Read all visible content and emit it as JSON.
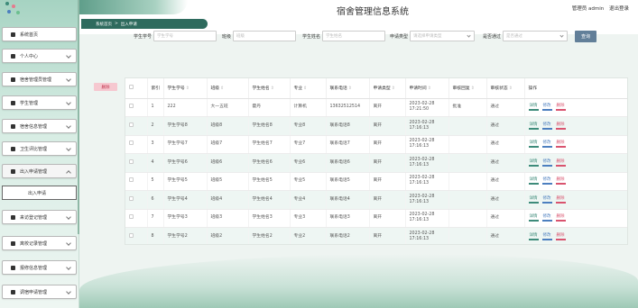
{
  "header": {
    "app_title": "宿舍管理信息系统",
    "user_role": "管理员 admin",
    "logout": "退出登录"
  },
  "breadcrumb": {
    "home": "系统首页",
    "sep": ">",
    "current": "出入申请"
  },
  "sidebar": {
    "items": [
      {
        "label": "系统首页",
        "icon": "home-icon"
      },
      {
        "label": "个人中心",
        "icon": "person-icon"
      },
      {
        "label": "宿舍管理员管理",
        "icon": "building-icon"
      },
      {
        "label": "学生管理",
        "icon": "heart-icon"
      },
      {
        "label": "宿舍信息管理",
        "icon": "building-icon"
      },
      {
        "label": "卫生评比管理",
        "icon": "person-icon"
      },
      {
        "label": "出入申请管理",
        "icon": "door-icon"
      },
      {
        "label": "出入申请",
        "icon": ""
      },
      {
        "label": "来访登记管理",
        "icon": "folder-icon"
      },
      {
        "label": "离校记录管理",
        "icon": "grid-icon"
      },
      {
        "label": "报修信息管理",
        "icon": "grid-icon"
      },
      {
        "label": "调宿申请管理",
        "icon": "sliders-icon"
      }
    ]
  },
  "search": {
    "student_no_label": "学生学号",
    "student_no_placeholder": "学生学号",
    "class_label": "班级",
    "class_placeholder": "班级",
    "student_name_label": "学生姓名",
    "student_name_placeholder": "学生姓名",
    "apply_type_label": "申请类型",
    "apply_type_placeholder": "请选择申请类型",
    "approved_label": "是否通过",
    "approved_placeholder": "是否通过",
    "query_button": "查询"
  },
  "actions": {
    "delete_button": "删除"
  },
  "table": {
    "columns": [
      "",
      "索引",
      "学生学号",
      "班级",
      "学生姓名",
      "专业",
      "联系电话",
      "申请类型",
      "申请时间",
      "审核回复",
      "审核状态",
      "操作"
    ],
    "op_labels": {
      "view": "详情",
      "edit": "修改",
      "delete": "删除"
    },
    "rows": [
      [
        "1",
        "222",
        "大一五班",
        "霍丹",
        "计算机",
        "13632512514",
        "离开",
        "2023-02-28 17:21:50",
        "批准",
        "通过"
      ],
      [
        "2",
        "学生学号8",
        "班级8",
        "学生姓名8",
        "专业8",
        "联系电话8",
        "离开",
        "2023-02-28 17:16:13",
        "",
        "通过"
      ],
      [
        "3",
        "学生学号7",
        "班级7",
        "学生姓名7",
        "专业7",
        "联系电话7",
        "离开",
        "2023-02-28 17:16:13",
        "",
        "通过"
      ],
      [
        "4",
        "学生学号6",
        "班级6",
        "学生姓名6",
        "专业6",
        "联系电话6",
        "离开",
        "2023-02-28 17:16:13",
        "",
        "通过"
      ],
      [
        "5",
        "学生学号5",
        "班级5",
        "学生姓名5",
        "专业5",
        "联系电话5",
        "离开",
        "2023-02-28 17:16:13",
        "",
        "通过"
      ],
      [
        "6",
        "学生学号4",
        "班级4",
        "学生姓名4",
        "专业4",
        "联系电话4",
        "离开",
        "2023-02-28 17:16:13",
        "",
        "通过"
      ],
      [
        "7",
        "学生学号3",
        "班级3",
        "学生姓名3",
        "专业3",
        "联系电话3",
        "离开",
        "2023-02-28 17:16:13",
        "",
        "通过"
      ],
      [
        "8",
        "学生学号2",
        "班级2",
        "学生姓名2",
        "专业2",
        "联系电话2",
        "离开",
        "2023-02-28 17:16:13",
        "",
        "通过"
      ],
      [
        "9",
        "学生学号1",
        "班级1",
        "学生姓名1",
        "专业1",
        "联系电话1",
        "离开",
        "2023-02-28 17:16:13",
        "",
        "通过"
      ]
    ]
  },
  "colors": {
    "accent": "#2e6b5e",
    "query": "#627f99",
    "danger": "#d9536e"
  }
}
